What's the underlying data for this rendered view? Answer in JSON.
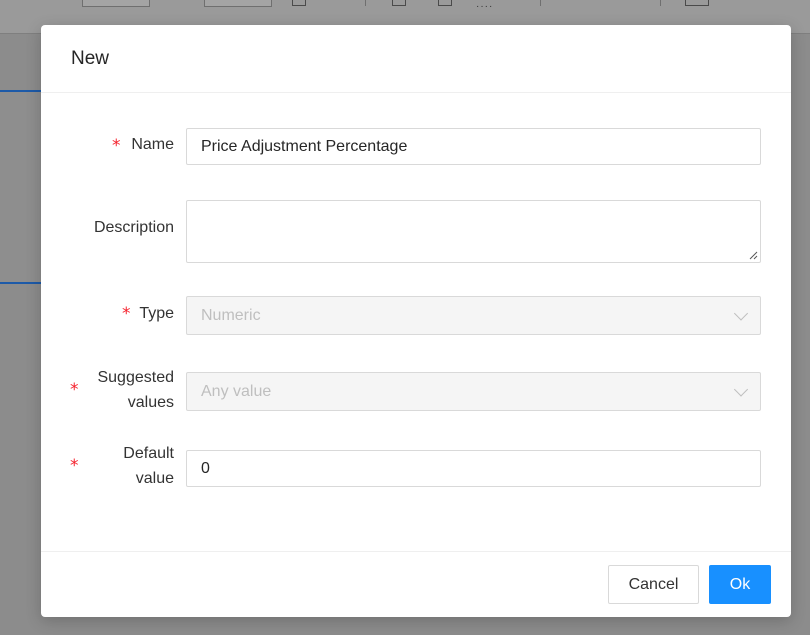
{
  "dialog": {
    "title": "New",
    "fields": {
      "name": {
        "label": "Name",
        "required": "*",
        "value": "Price Adjustment Percentage"
      },
      "description": {
        "label": "Description",
        "value": ""
      },
      "type": {
        "label": "Type",
        "required": "*",
        "value": "Numeric"
      },
      "suggested_values": {
        "label_line1": "Suggested",
        "label_line2": "values",
        "required": "*",
        "value": "Any value"
      },
      "default_value": {
        "label_line1": "Default",
        "label_line2": "value",
        "required": "*",
        "value": "0"
      }
    },
    "buttons": {
      "cancel": "Cancel",
      "ok": "Ok"
    }
  },
  "colors": {
    "primary": "#1890ff",
    "required_marker": "#f5222d",
    "overlay": "#8c8c8c",
    "disabled_bg": "#f5f5f5"
  },
  "icons": {
    "select_arrow": "chevron-down-icon",
    "textarea_resize": "resize-handle-icon"
  }
}
